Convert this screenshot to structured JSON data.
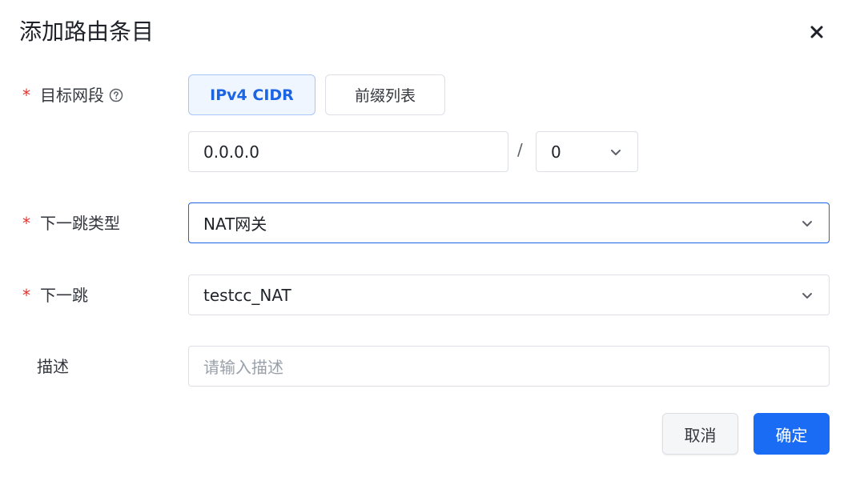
{
  "dialog": {
    "title": "添加路由条目"
  },
  "form": {
    "destination": {
      "required_mark": "*",
      "label": "目标网段",
      "segments": [
        "IPv4 CIDR",
        "前缀列表"
      ],
      "ip_value": "0.0.0.0",
      "separator": "/",
      "mask_value": "0"
    },
    "next_hop_type": {
      "required_mark": "*",
      "label": "下一跳类型",
      "value": "NAT网关"
    },
    "next_hop": {
      "required_mark": "*",
      "label": "下一跳",
      "value": "testcc_NAT"
    },
    "description": {
      "label": "描述",
      "placeholder": "请输入描述"
    }
  },
  "footer": {
    "cancel_label": "取消",
    "ok_label": "确定"
  },
  "colors": {
    "accent": "#1a6cf5",
    "required": "#e2312b",
    "border": "#dcdfe5"
  },
  "icons": {
    "close": "close-icon",
    "help": "help-circle-icon",
    "dropdown": "chevron-down-icon"
  }
}
